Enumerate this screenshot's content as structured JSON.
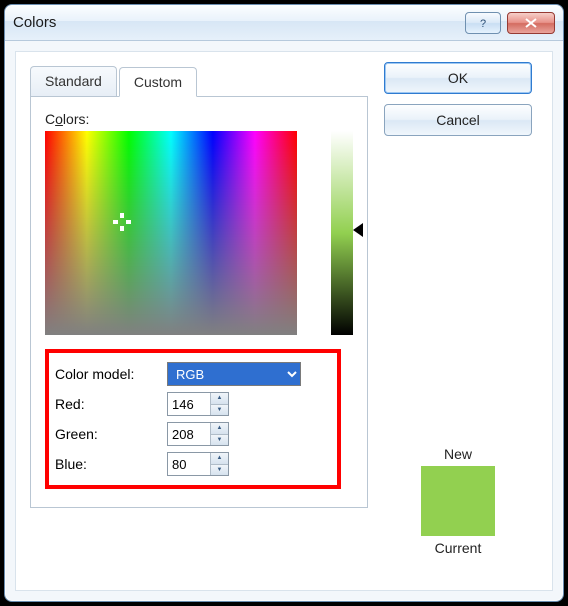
{
  "window": {
    "title": "Colors"
  },
  "titlebar": {
    "help_tooltip": "?",
    "close_tooltip": "X"
  },
  "tabs": {
    "standard": "Standard",
    "custom": "Custom"
  },
  "buttons": {
    "ok": "OK",
    "cancel": "Cancel"
  },
  "colors_label": {
    "pre": "C",
    "u": "o",
    "post": "lors:"
  },
  "color_model_label": "Color model:",
  "color_model_value": "RGB",
  "red": {
    "label_u": "R",
    "label_rest": "ed:",
    "value": "146"
  },
  "green": {
    "label_u": "G",
    "label_rest": "reen:",
    "value": "208"
  },
  "blue": {
    "label_u": "B",
    "label_rest": "lue:",
    "value": "80"
  },
  "preview": {
    "new_label": "New",
    "current_label": "Current",
    "new_color": "#92d050"
  }
}
